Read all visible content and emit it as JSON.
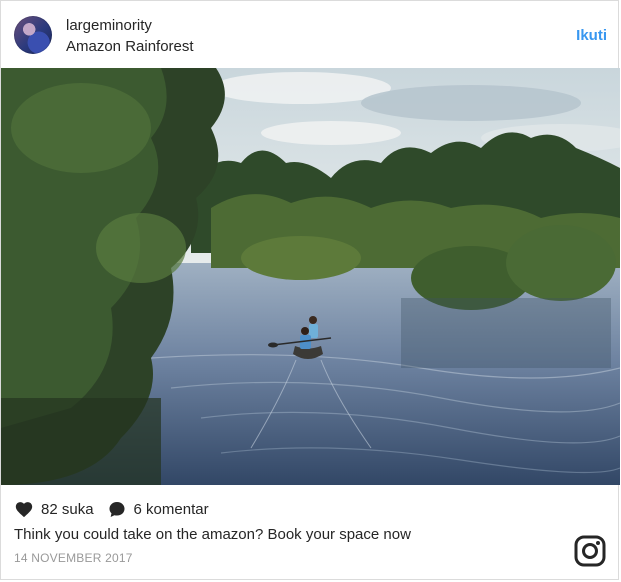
{
  "post": {
    "username": "largeminority",
    "location": "Amazon Rainforest",
    "follow_label": "Ikuti",
    "likes_text": "82 suka",
    "comments_text": "6 komentar",
    "caption": "Think you could take on the amazon? Book your space now",
    "date": "14 NOVEMBER 2017"
  },
  "icons": {
    "like": "heart-icon",
    "comment": "comment-bubble-icon",
    "brand": "instagram-logo-icon"
  },
  "colors": {
    "link_blue": "#3897f0",
    "text": "#262626",
    "muted": "#999999",
    "border": "#dbdbdb"
  }
}
